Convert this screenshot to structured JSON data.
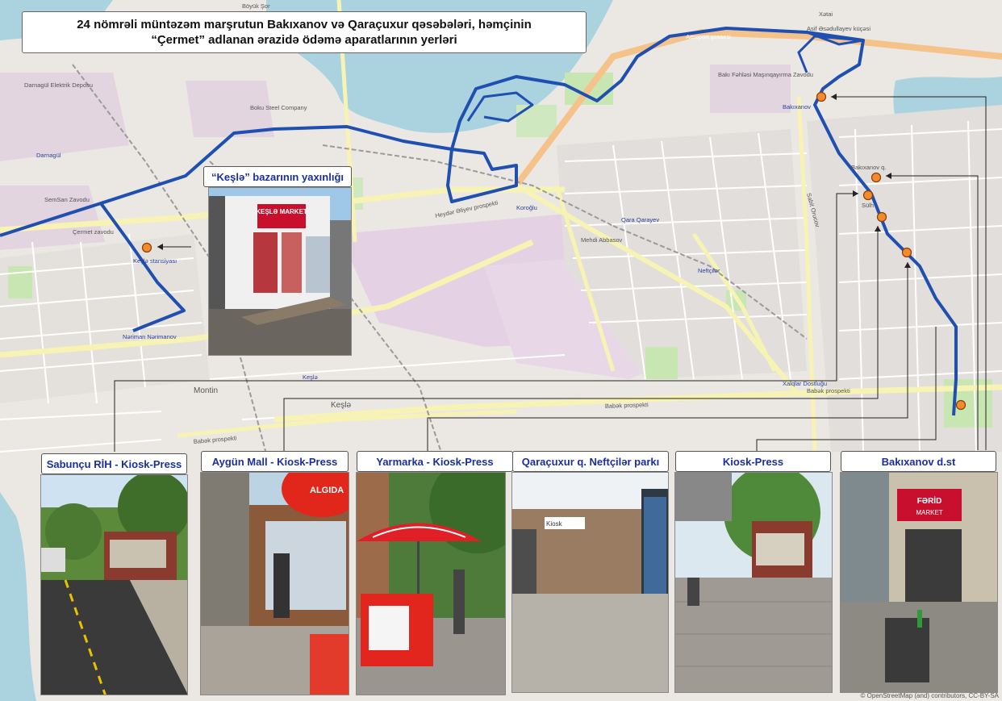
{
  "title": {
    "line1": "24 nömrəli müntəzəm marşrutun Bakıxanov və Qaraçuxur qəsəbələri, həmçinin",
    "line2": "“Çermet” adlanan ərazidə ödəmə aparatlarının yerləri"
  },
  "keshla_callout": "“Keşlə” bazarının yaxınlığı",
  "callouts": [
    "Sabunçu RİH - Kiosk-Press",
    "Aygün Mall - Kiosk-Press",
    "Yarmarka - Kiosk-Press",
    "Qaraçuxur q. Neftçilər parkı",
    "Kiosk-Press",
    "Bakıxanov d.st"
  ],
  "map_labels": {
    "boyuk_shor": "Böyük Şor",
    "xetai": "Xətai",
    "darnagul_elektrik": "Darnagül Elektrik Deposu",
    "darnagul": "Darnagül",
    "semsan": "SemSan Zavodu",
    "chermet": "Çermet zavodu",
    "keshla_stansiyasi": "Keşlə stansiyası",
    "nariman": "Nəriman Nərimanov",
    "baku_steel": "Boku Steel Company",
    "airport_road": "Aeroport şossesi",
    "asif": "Asif Əsədullayev küçəsi",
    "baki_fahlasi": "Bakı Fəhləsi Maşınqayırma Zavodu",
    "bakixanov_station": "Bakıxanov",
    "bakixanov_q": "Bakıxanov q.",
    "sabit": "Sabit Orucov",
    "koroglu": "Koroğlu",
    "qara_qarayev": "Qara Qarayev",
    "mehdi": "Mehdi Abbasov",
    "neftchilar": "Neftçilər",
    "heyder": "Heydər Əliyev prospekti",
    "babak1": "Babək prospekti",
    "babak2": "Babək prospekti",
    "babak3": "Babək prospekti",
    "montin": "Montin",
    "keshla": "Keşlə",
    "keshla2": "Keşlə",
    "xalglar": "Xalqlar Dostluğu",
    "sulh": "Sülh"
  },
  "attribution": "© OpenStreetMap (and) contributors, CC-BY-SA",
  "colors": {
    "route": "#1f4fb0",
    "marker": "#f28a2e",
    "callout_text": "#1a2f9c",
    "water": "#aad3df",
    "industrial": "#e3cde3",
    "park": "#c8e6b2"
  },
  "photo_scenes": [
    "Keşlə bazar building with red sign",
    "street with kiosk",
    "mall entrance kiosk",
    "ice cream umbrellas kiosk",
    "park entrance",
    "bus stop kiosk",
    "market entrance"
  ],
  "photo_signs": {
    "keshla_market": "KEŞLƏ MARKET",
    "algida": "ALGIDA",
    "kiosk": "Kiosk",
    "farid": "FƏRİD",
    "market": "MARKET"
  }
}
